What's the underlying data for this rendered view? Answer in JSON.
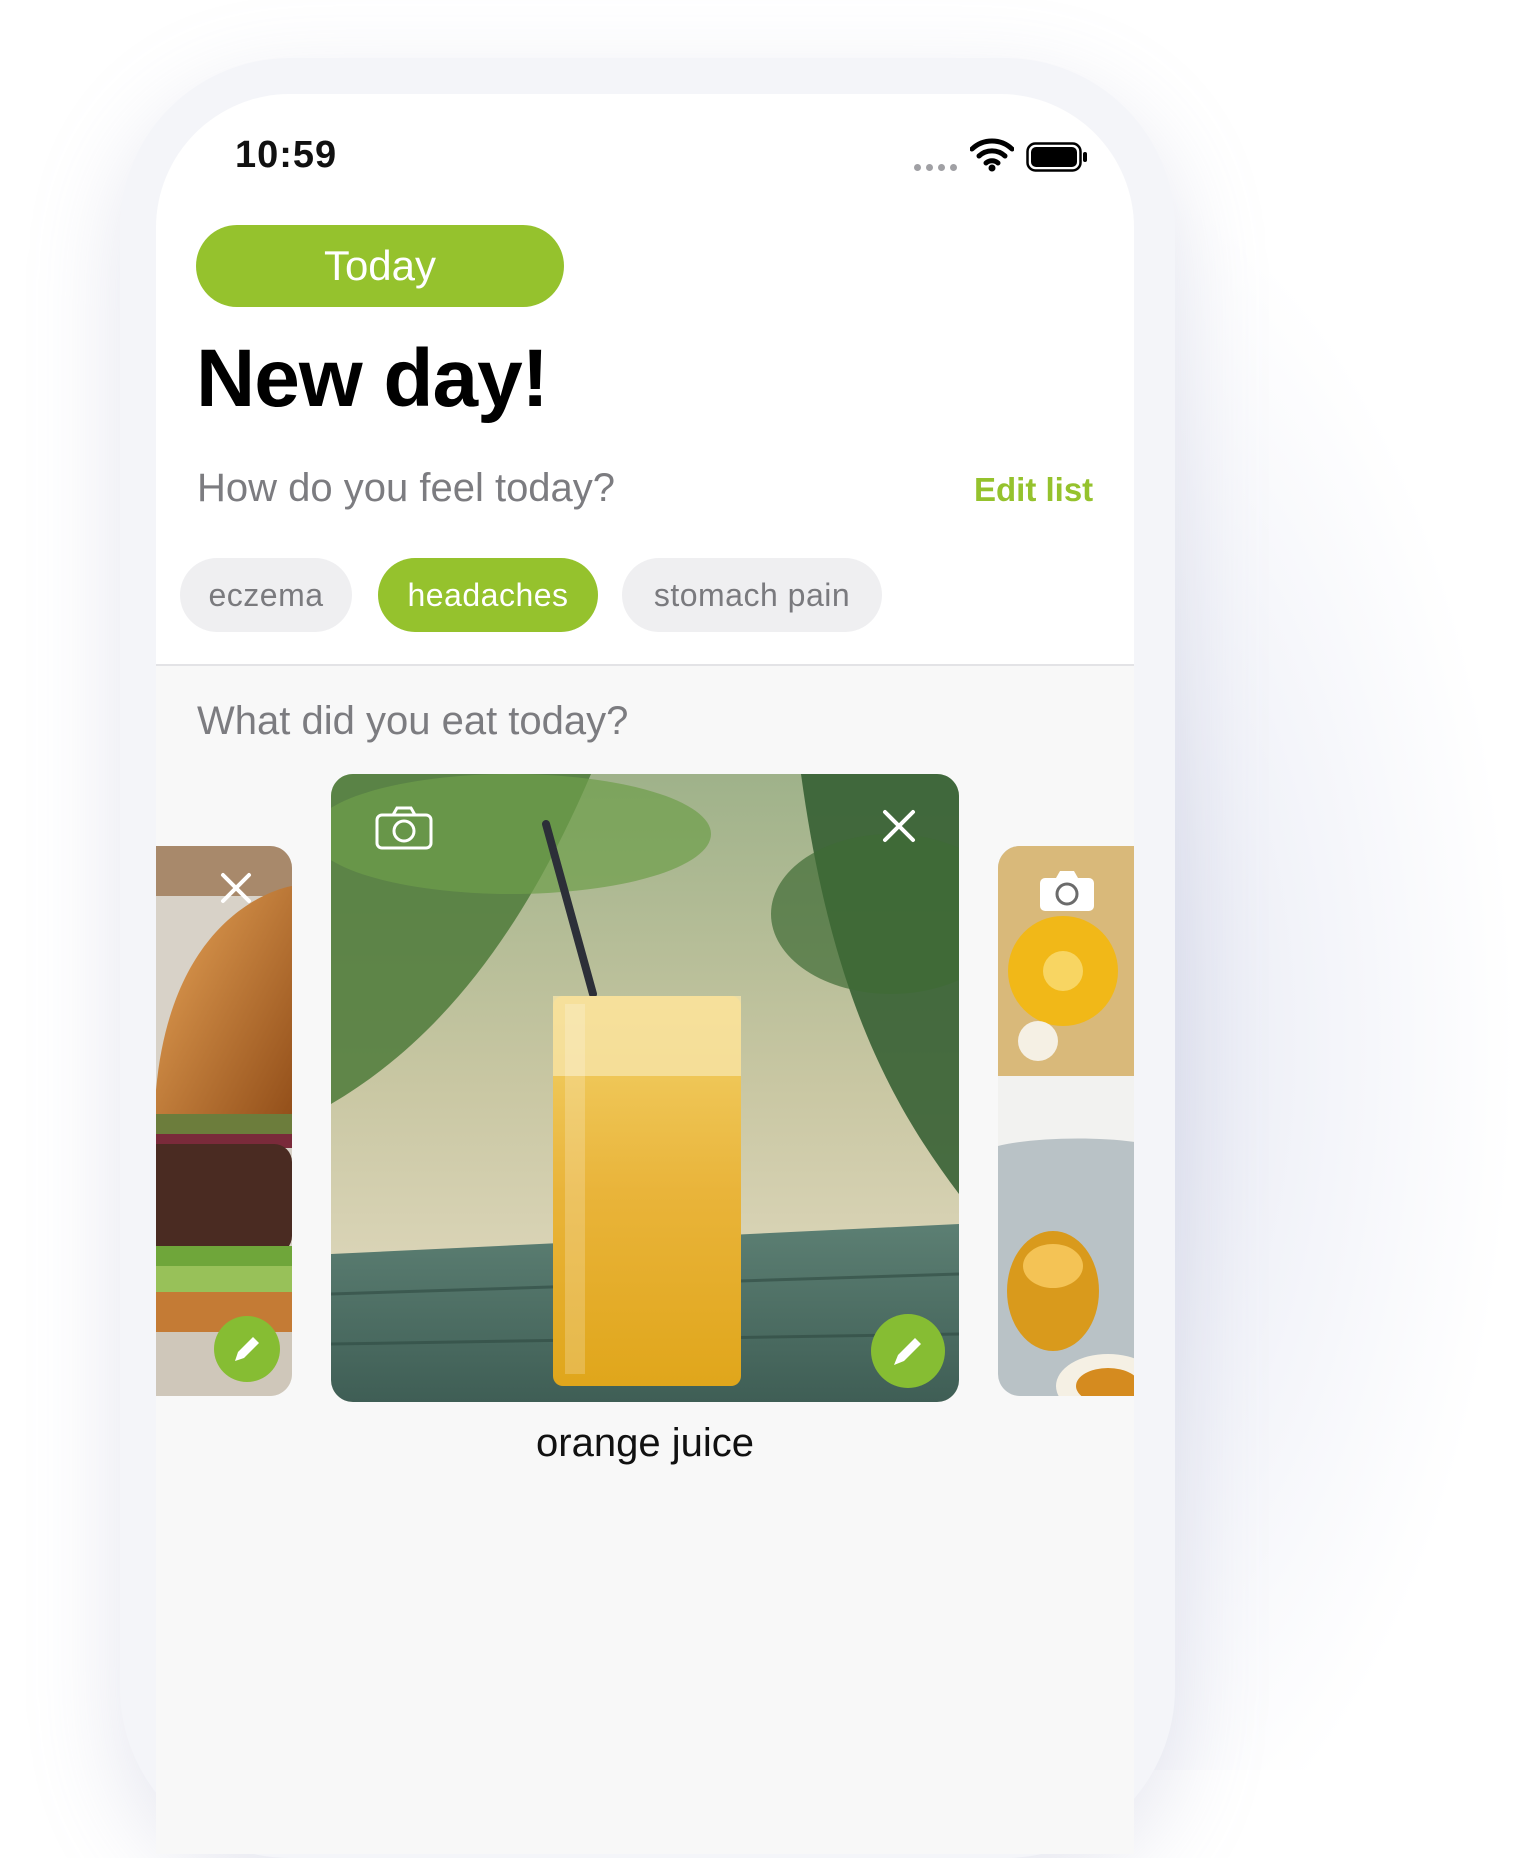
{
  "status_bar": {
    "time": "10:59",
    "wifi_icon": "wifi-icon",
    "battery_icon": "battery-icon"
  },
  "header": {
    "today_label": "Today",
    "title": "New day!"
  },
  "symptoms": {
    "question": "How do you feel today?",
    "edit_label": "Edit list",
    "chips": [
      {
        "label": "eczema",
        "selected": false
      },
      {
        "label": "headaches",
        "selected": true
      },
      {
        "label": "stomach pain",
        "selected": false
      }
    ]
  },
  "food": {
    "question": "What did you eat today?",
    "cards": [
      {
        "image": "burger-photo",
        "icons": [
          "close-icon",
          "edit-icon"
        ]
      },
      {
        "image": "orange-juice-photo",
        "icons": [
          "camera-icon",
          "close-icon",
          "edit-icon"
        ]
      },
      {
        "image": "pancake-photo",
        "icons": [
          "camera-icon"
        ]
      }
    ],
    "selected_name": "orange juice"
  },
  "colors": {
    "accent": "#95c22d",
    "chip_inactive": "#efeff1",
    "text_secondary": "#7c7c80"
  }
}
